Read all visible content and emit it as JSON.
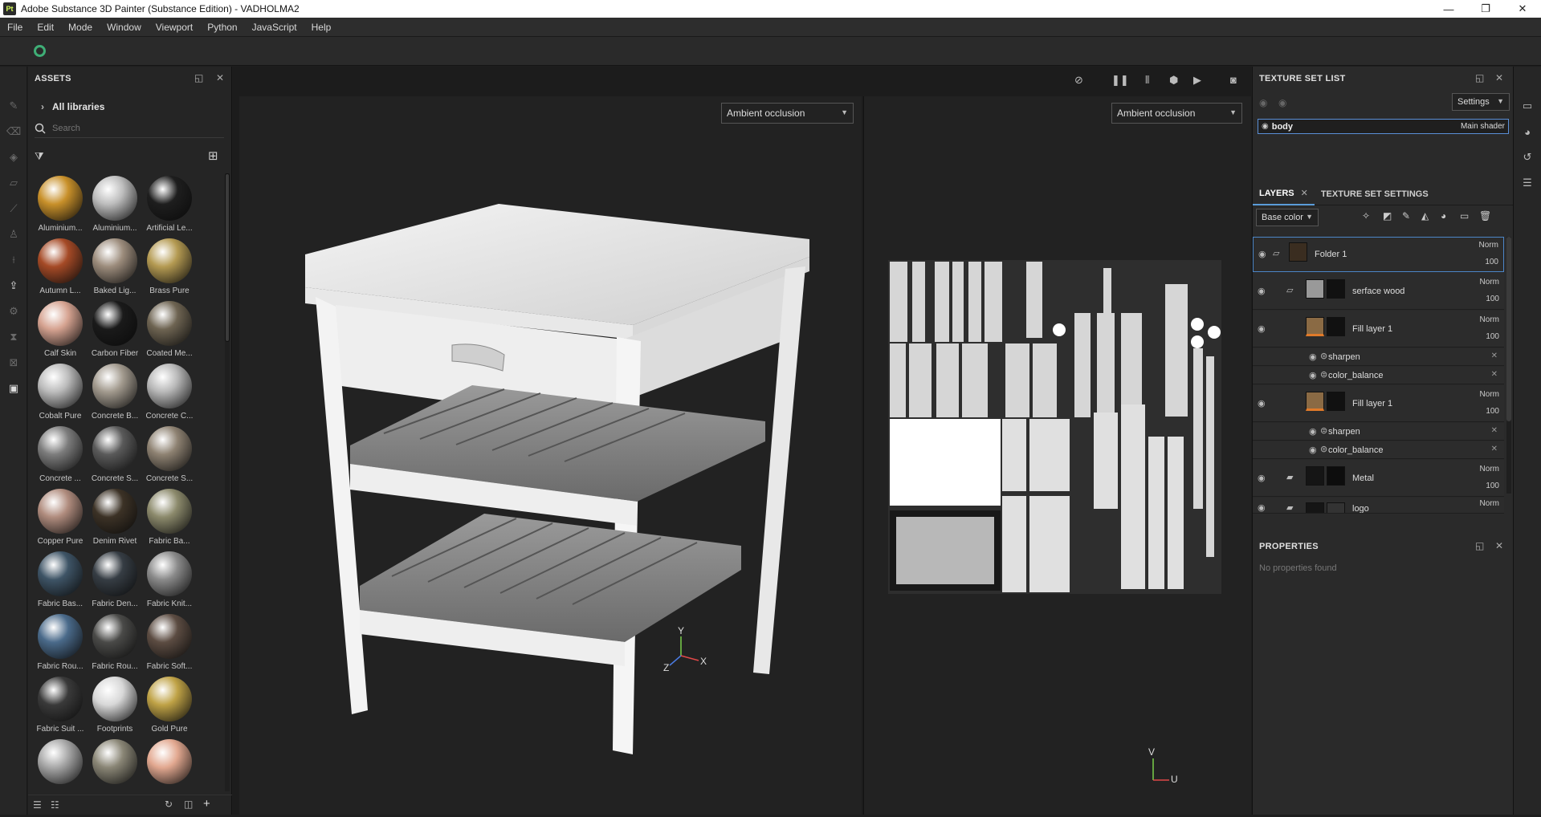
{
  "window": {
    "title": "Adobe Substance 3D Painter (Substance Edition) - VADHOLMA2",
    "app_icon": "Pt",
    "minimize": "—",
    "maximize": "❐",
    "close": "✕"
  },
  "menu": [
    "File",
    "Edit",
    "Mode",
    "Window",
    "Viewport",
    "Python",
    "JavaScript",
    "Help"
  ],
  "assets": {
    "header": "ASSETS",
    "libraries_label": "All libraries",
    "search_placeholder": "Search",
    "items": [
      {
        "label": "Aluminium...",
        "color": "#c8902a"
      },
      {
        "label": "Aluminium...",
        "color": "#bdbdbd"
      },
      {
        "label": "Artificial Le...",
        "color": "#1e1e1e"
      },
      {
        "label": "Autumn L...",
        "color": "#a54a26"
      },
      {
        "label": "Baked Lig...",
        "color": "#9c8c7c"
      },
      {
        "label": "Brass Pure",
        "color": "#b49a52"
      },
      {
        "label": "Calf Skin",
        "color": "#d6a391"
      },
      {
        "label": "Carbon Fiber",
        "color": "#1a1a1a"
      },
      {
        "label": "Coated Me...",
        "color": "#6e6452"
      },
      {
        "label": "Cobalt Pure",
        "color": "#bcbcbc"
      },
      {
        "label": "Concrete B...",
        "color": "#a29a8e"
      },
      {
        "label": "Concrete C...",
        "color": "#b8b8b8"
      },
      {
        "label": "Concrete ...",
        "color": "#7c7c7c"
      },
      {
        "label": "Concrete S...",
        "color": "#5a5a5a"
      },
      {
        "label": "Concrete S...",
        "color": "#8e8272"
      },
      {
        "label": "Copper Pure",
        "color": "#b08c7e"
      },
      {
        "label": "Denim Rivet",
        "color": "#3c3226"
      },
      {
        "label": "Fabric Ba...",
        "color": "#8c8a6c"
      },
      {
        "label": "Fabric Bas...",
        "color": "#3e5466"
      },
      {
        "label": "Fabric Den...",
        "color": "#363d44"
      },
      {
        "label": "Fabric Knit...",
        "color": "#8a8a8a"
      },
      {
        "label": "Fabric Rou...",
        "color": "#4a6a8a"
      },
      {
        "label": "Fabric Rou...",
        "color": "#4a4a48"
      },
      {
        "label": "Fabric Soft...",
        "color": "#5c4c42"
      },
      {
        "label": "Fabric Suit ...",
        "color": "#3a3a3a"
      },
      {
        "label": "Footprints",
        "color": "#d8d8d8"
      },
      {
        "label": "Gold Pure",
        "color": "#bfa246"
      },
      {
        "label": "",
        "color": "#a8a8a8"
      },
      {
        "label": "",
        "color": "#8a8676"
      },
      {
        "label": "",
        "color": "#e2a890"
      }
    ]
  },
  "viewport": {
    "dropdown_3d": "Ambient occlusion",
    "dropdown_2d": "Ambient occlusion",
    "axis_3d": {
      "y": "Y",
      "z": "Z",
      "x": "X"
    },
    "axis_2d": {
      "v": "V",
      "u": "U"
    }
  },
  "texture_set_list": {
    "header": "TEXTURE SET LIST",
    "settings_label": "Settings",
    "body_name": "body",
    "body_shader": "Main shader"
  },
  "layers": {
    "tab_layers": "LAYERS",
    "tab_texture_settings": "TEXTURE SET SETTINGS",
    "channel": "Base color",
    "rows": [
      {
        "name": "Folder 1",
        "blend": "Norm",
        "opacity": "100"
      },
      {
        "name": "serface wood",
        "blend": "Norm",
        "opacity": "100"
      },
      {
        "name": "Fill layer 1",
        "blend": "Norm",
        "opacity": "100"
      },
      {
        "name": "Fill layer 1",
        "blend": "Norm",
        "opacity": "100"
      },
      {
        "name": "Metal",
        "blend": "Norm",
        "opacity": "100"
      },
      {
        "name": "logo",
        "blend": "Norm",
        "opacity": ""
      }
    ],
    "effects": [
      {
        "name": "sharpen"
      },
      {
        "name": "color_balance"
      },
      {
        "name": "sharpen"
      },
      {
        "name": "color_balance"
      }
    ]
  },
  "properties": {
    "header": "PROPERTIES",
    "empty_text": "No properties found"
  },
  "colors": {
    "accent": "#4c86c8",
    "logo_ring": "#3fae76"
  }
}
